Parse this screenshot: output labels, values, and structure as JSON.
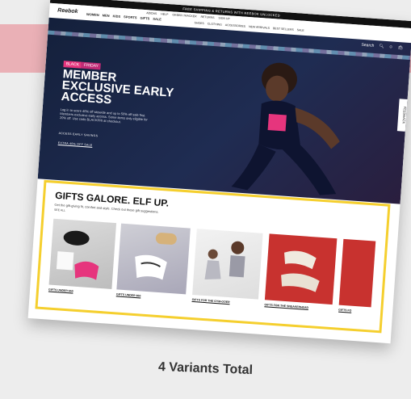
{
  "topbar": {
    "text": "FREE SHIPPING & RETURNS WITH REEBOK UNLOCKED"
  },
  "nav": {
    "logo": "Reebok",
    "categories": [
      "WOMEN",
      "MEN",
      "KIDS",
      "SPORTS",
      "GIFTS",
      "SALE"
    ],
    "utility": [
      "ADIDAS",
      "HELP",
      "ORDER TRACKER",
      "RETURNS",
      "SIGN UP"
    ],
    "promo_links": [
      "SHOES",
      "CLOTHING",
      "ACCESSORIES",
      "NEW ARRIVALS",
      "BEST SELLERS",
      "SALE"
    ],
    "search_label": "Search"
  },
  "hero": {
    "badge_1": "BLACK",
    "badge_2": "FRIDAY",
    "headline": "MEMBER EXCLUSIVE EARLY ACCESS",
    "subcopy": "Log in to score 40% off sitewide and up to 50% off sale first. Members exclusive early access. Some items only eligible for 20% off. Use code BLACKFRI at checkout.",
    "cta_primary": "ACCESS EARLY SAVINGS",
    "cta_secondary": "EXTRA 40% OFF SALE",
    "feedback": "FEEDBACK"
  },
  "gifts": {
    "title": "GIFTS GALORE. ELF UP.",
    "description": "Get the gift-giving fit, comfort and style. Check out these gift suggestions.",
    "see_all": "SEE ALL",
    "tiles": [
      {
        "caption": "GIFTS UNDER $50"
      },
      {
        "caption": "GIFTS UNDER $50"
      },
      {
        "caption": "GIFTS FOR THE GYM-GOER"
      },
      {
        "caption": "GIFTS FOR THE SNEAKERHEAD"
      },
      {
        "caption": "GIFTS FO"
      }
    ]
  },
  "footer": {
    "text": "4 Variants Total"
  },
  "colors": {
    "accent_yellow": "#f5cf2e",
    "pink_badge": "#e6357d",
    "hero_bg": "#1f2c52"
  }
}
